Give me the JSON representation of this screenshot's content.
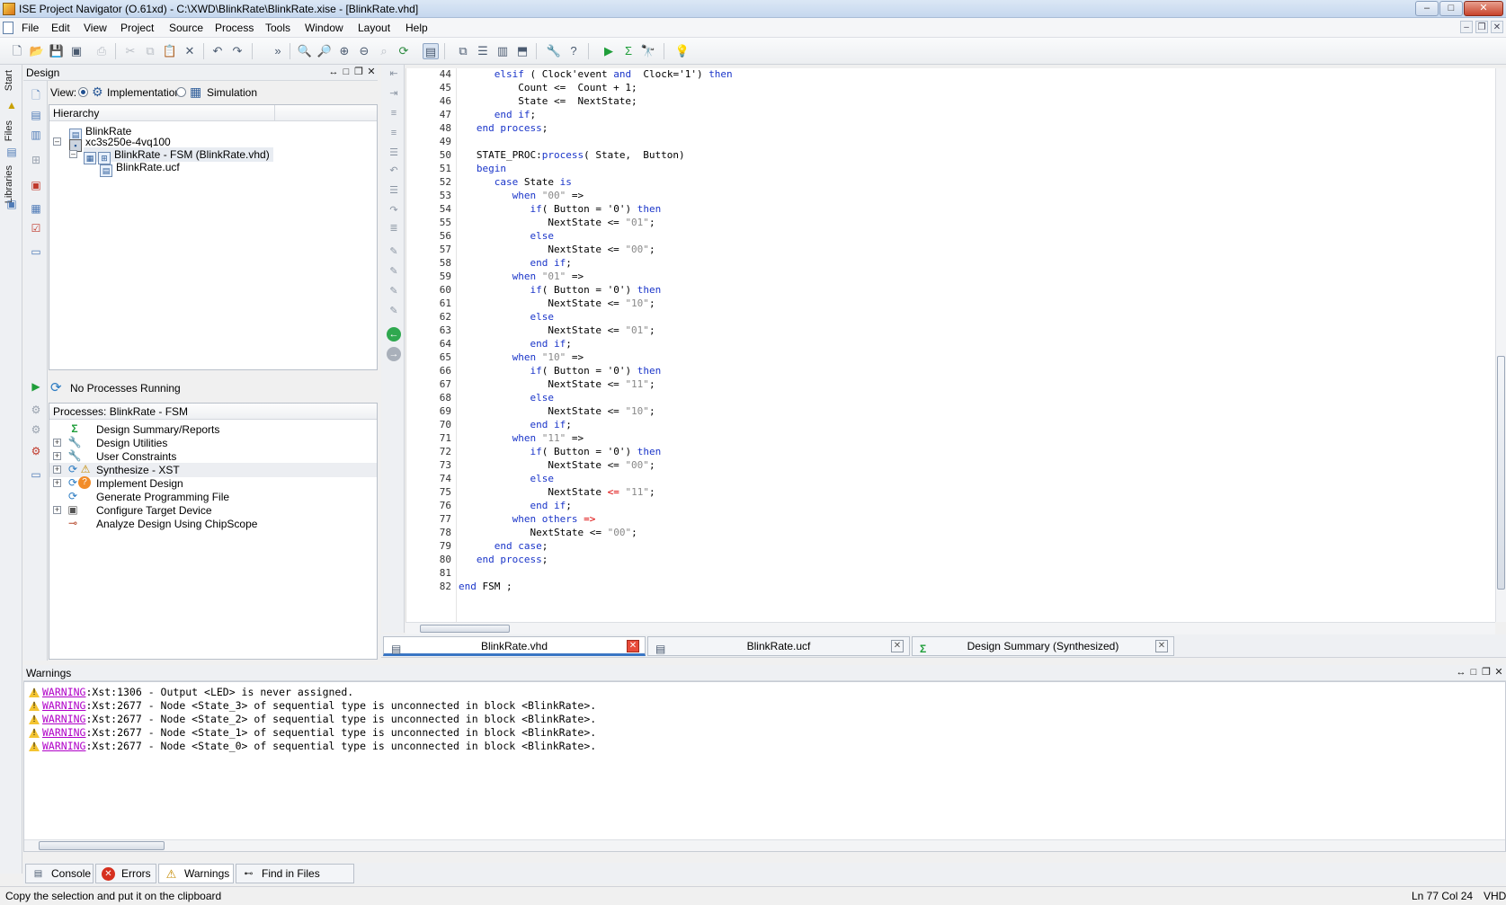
{
  "window": {
    "title": "ISE Project Navigator (O.61xd) - C:\\XWD\\BlinkRate\\BlinkRate.xise - [BlinkRate.vhd]",
    "controls": [
      "–",
      "□",
      "✕"
    ]
  },
  "menu": [
    "File",
    "Edit",
    "View",
    "Project",
    "Source",
    "Process",
    "Tools",
    "Window",
    "Layout",
    "Help"
  ],
  "left_tabs": [
    "Start",
    "Files",
    "Libraries"
  ],
  "design": {
    "panel_title": "Design",
    "view_label": "View:",
    "view_implementation": "Implementation",
    "view_simulation": "Simulation",
    "hierarchy_header": "Hierarchy",
    "tree": [
      {
        "label": "BlinkRate",
        "icon": "project-icon"
      },
      {
        "label": "xc3s250e-4vq100",
        "icon": "chip-icon"
      },
      {
        "label": "BlinkRate - FSM (BlinkRate.vhd)",
        "icon": "vhdl-module-icon"
      },
      {
        "label": "BlinkRate.ucf",
        "icon": "ucf-file-icon"
      }
    ]
  },
  "processes": {
    "status": "No Processes Running",
    "header": "Processes: BlinkRate - FSM",
    "items": [
      {
        "label": "Design Summary/Reports",
        "icon": "sigma-icon"
      },
      {
        "label": "Design Utilities",
        "icon": "tools-icon"
      },
      {
        "label": "User Constraints",
        "icon": "tools-icon"
      },
      {
        "label": "Synthesize - XST",
        "icon": "warning-icon"
      },
      {
        "label": "Implement Design",
        "icon": "question-icon"
      },
      {
        "label": "Generate Programming File",
        "icon": "refresh-icon"
      },
      {
        "label": "Configure Target Device",
        "icon": "device-icon"
      },
      {
        "label": "Analyze Design Using ChipScope",
        "icon": "chipscope-icon"
      }
    ]
  },
  "editor": {
    "lines": [
      {
        "n": "44",
        "html": "      <span class=\"kw\">elsif</span> ( Clock'event <span class=\"kw\">and</span>  Clock='1') <span class=\"kw\">then</span>"
      },
      {
        "n": "45",
        "html": "          Count &lt;=  Count + 1;"
      },
      {
        "n": "46",
        "html": "          State &lt;=  NextState;"
      },
      {
        "n": "47",
        "html": "      <span class=\"kw\">end if</span>;"
      },
      {
        "n": "48",
        "html": "   <span class=\"kw\">end process</span>;"
      },
      {
        "n": "49",
        "html": ""
      },
      {
        "n": "50",
        "html": "   STATE_PROC:<span class=\"kw\">process</span>( State,  Button)"
      },
      {
        "n": "51",
        "html": "   <span class=\"kw\">begin</span>"
      },
      {
        "n": "52",
        "html": "      <span class=\"kw\">case</span> State <span class=\"kw\">is</span>"
      },
      {
        "n": "53",
        "html": "         <span class=\"kw\">when</span> <span class=\"str\">\"00\"</span> =&gt;"
      },
      {
        "n": "54",
        "html": "            <span class=\"kw\">if</span>( Button = '0') <span class=\"kw\">then</span>"
      },
      {
        "n": "55",
        "html": "               NextState &lt;= <span class=\"str\">\"01\"</span>;"
      },
      {
        "n": "56",
        "html": "            <span class=\"kw\">else</span>"
      },
      {
        "n": "57",
        "html": "               NextState &lt;= <span class=\"str\">\"00\"</span>;"
      },
      {
        "n": "58",
        "html": "            <span class=\"kw\">end if</span>;"
      },
      {
        "n": "59",
        "html": "         <span class=\"kw\">when</span> <span class=\"str\">\"01\"</span> =&gt;"
      },
      {
        "n": "60",
        "html": "            <span class=\"kw\">if</span>( Button = '0') <span class=\"kw\">then</span>"
      },
      {
        "n": "61",
        "html": "               NextState &lt;= <span class=\"str\">\"10\"</span>;"
      },
      {
        "n": "62",
        "html": "            <span class=\"kw\">else</span>"
      },
      {
        "n": "63",
        "html": "               NextState &lt;= <span class=\"str\">\"01\"</span>;"
      },
      {
        "n": "64",
        "html": "            <span class=\"kw\">end if</span>;"
      },
      {
        "n": "65",
        "html": "         <span class=\"kw\">when</span> <span class=\"str\">\"10\"</span> =&gt;"
      },
      {
        "n": "66",
        "html": "            <span class=\"kw\">if</span>( Button = '0') <span class=\"kw\">then</span>"
      },
      {
        "n": "67",
        "html": "               NextState &lt;= <span class=\"str\">\"11\"</span>;"
      },
      {
        "n": "68",
        "html": "            <span class=\"kw\">else</span>"
      },
      {
        "n": "69",
        "html": "               NextState &lt;= <span class=\"str\">\"10\"</span>;"
      },
      {
        "n": "70",
        "html": "            <span class=\"kw\">end if</span>;"
      },
      {
        "n": "71",
        "html": "         <span class=\"kw\">when</span> <span class=\"str\">\"11\"</span> =&gt;"
      },
      {
        "n": "72",
        "html": "            <span class=\"kw\">if</span>( Button = '0') <span class=\"kw\">then</span>"
      },
      {
        "n": "73",
        "html": "               NextState &lt;= <span class=\"str\">\"00\"</span>;"
      },
      {
        "n": "74",
        "html": "            <span class=\"kw\">else</span>"
      },
      {
        "n": "75",
        "html": "               NextState <span style=\"color:#d00\">&lt;=</span> <span class=\"str\">\"11\"</span>;"
      },
      {
        "n": "76",
        "html": "            <span class=\"kw\">end if</span>;"
      },
      {
        "n": "77",
        "html": "         <span class=\"kw\">when others</span> <span style=\"color:#d00\">=&gt;</span>"
      },
      {
        "n": "78",
        "html": "            NextState &lt;= <span class=\"str\">\"00\"</span>;"
      },
      {
        "n": "79",
        "html": "      <span class=\"kw\">end case</span>;"
      },
      {
        "n": "80",
        "html": "   <span class=\"kw\">end process</span>;"
      },
      {
        "n": "81",
        "html": ""
      },
      {
        "n": "82",
        "html": "<span class=\"kw\">end</span> FSM ;"
      }
    ],
    "tabs": [
      {
        "label": "BlinkRate.vhd",
        "active": true
      },
      {
        "label": "BlinkRate.ucf",
        "active": false
      },
      {
        "label": "Design Summary (Synthesized)",
        "active": false
      }
    ]
  },
  "warnings": {
    "panel_title": "Warnings",
    "lines": [
      {
        "tag": "WARNING",
        "text": ":Xst:1306 - Output <LED> is never assigned."
      },
      {
        "tag": "WARNING",
        "text": ":Xst:2677 - Node <State_3> of sequential type is unconnected in block <BlinkRate>."
      },
      {
        "tag": "WARNING",
        "text": ":Xst:2677 - Node <State_2> of sequential type is unconnected in block <BlinkRate>."
      },
      {
        "tag": "WARNING",
        "text": ":Xst:2677 - Node <State_1> of sequential type is unconnected in block <BlinkRate>."
      },
      {
        "tag": "WARNING",
        "text": ":Xst:2677 - Node <State_0> of sequential type is unconnected in block <BlinkRate>."
      }
    ]
  },
  "bottom_tabs": [
    {
      "label": "Console",
      "icon": "console-icon"
    },
    {
      "label": "Errors",
      "icon": "error-icon"
    },
    {
      "label": "Warnings",
      "icon": "warning-icon",
      "active": true
    },
    {
      "label": "Find in Files Results",
      "icon": "binoculars-icon"
    }
  ],
  "status": {
    "message": "Copy the selection and put it on the clipboard",
    "position": "Ln 77 Col 24",
    "language": "VHDL"
  },
  "colors": {
    "keyword": "#1a35c9",
    "string": "#888888",
    "warning_link": "#b000c8",
    "active_tab_accent": "#3a76c4"
  }
}
